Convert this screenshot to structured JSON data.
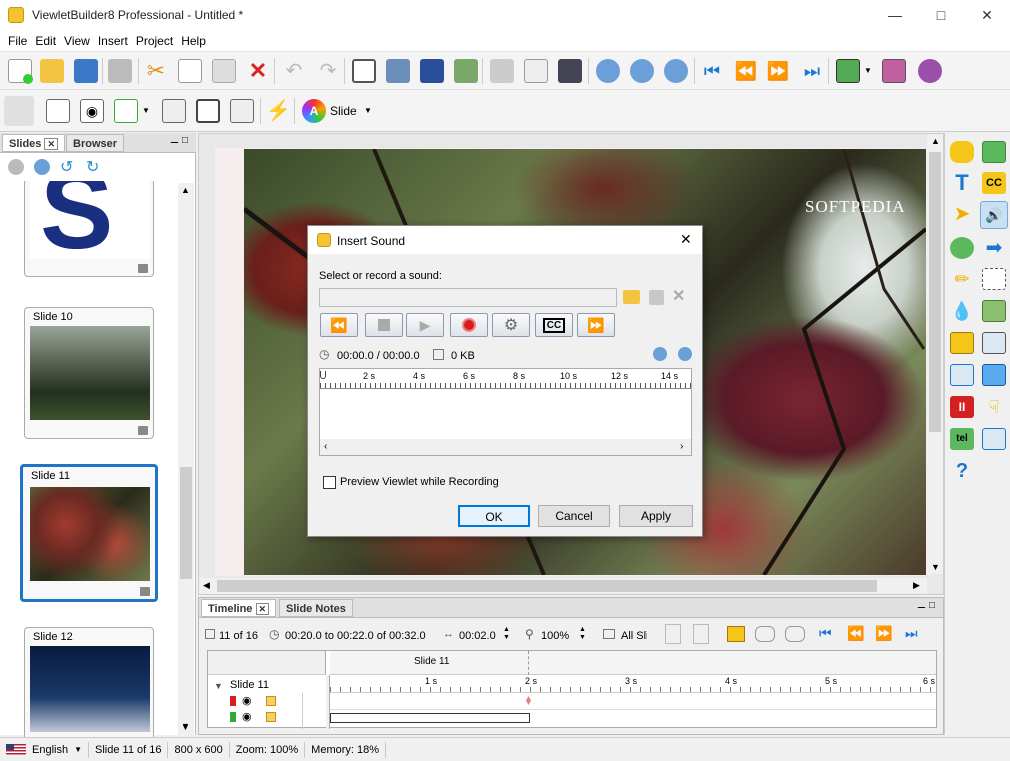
{
  "window": {
    "title": "ViewletBuilder8 Professional - Untitled *"
  },
  "menu": [
    "File",
    "Edit",
    "View",
    "Insert",
    "Project",
    "Help"
  ],
  "toolbar2": {
    "theme_label": "Slide"
  },
  "slides_panel": {
    "tabs": [
      "Slides",
      "Browser"
    ],
    "thumbnails": [
      {
        "label": "Slide 10"
      },
      {
        "label": "Slide 11"
      },
      {
        "label": "Slide 12"
      }
    ]
  },
  "watermark": "SOFTPEDIA",
  "dialog": {
    "title": "Insert Sound",
    "prompt": "Select or record a sound:",
    "time": "00:00.0 / 00:00.0",
    "size": "0 KB",
    "ruler_ticks": [
      "2 s",
      "4 s",
      "6 s",
      "8 s",
      "10 s",
      "12 s",
      "14 s"
    ],
    "preview_checkbox": "Preview Viewlet while Recording",
    "ok": "OK",
    "cancel": "Cancel",
    "apply": "Apply"
  },
  "timeline": {
    "tabs": [
      "Timeline",
      "Slide Notes"
    ],
    "position": "11 of 16",
    "range": "00:20.0 to 00:22.0 of 00:32.0",
    "duration": "00:02.0",
    "zoom": "100%",
    "all_slides": "All Sli",
    "slide_header": "Slide 11",
    "row_label": "Slide 11",
    "ticks": [
      "1 s",
      "2 s",
      "3 s",
      "4 s",
      "5 s",
      "6 s"
    ]
  },
  "status": {
    "language": "English",
    "slide": "Slide 11 of 16",
    "resolution": "800 x 600",
    "zoom": "Zoom: 100%",
    "memory": "Memory: 18%"
  },
  "colors": {
    "accent": "#0078d7",
    "selected_thumb": "#1e74c8",
    "record": "#d42020"
  }
}
